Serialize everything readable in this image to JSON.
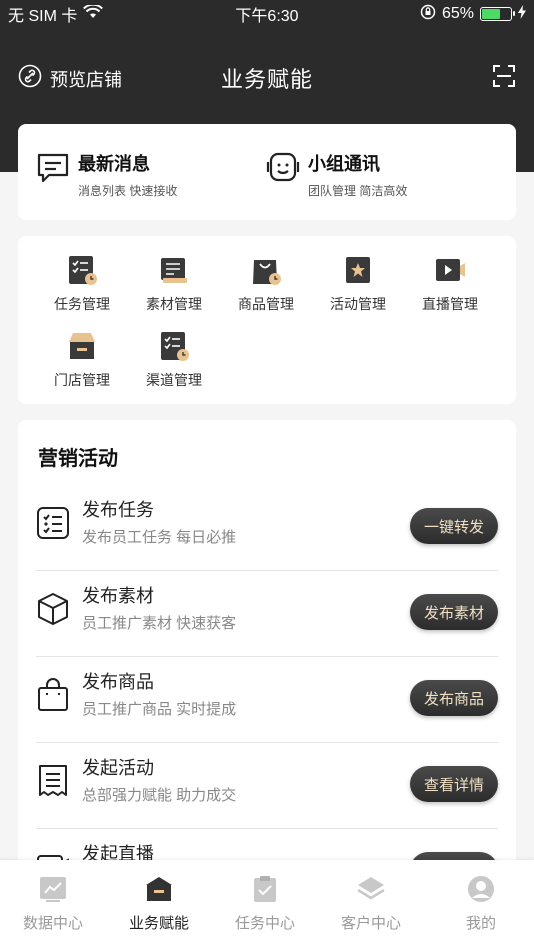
{
  "status": {
    "carrier": "无 SIM 卡",
    "time": "下午6:30",
    "battery": "65%",
    "battery_level": 0.65
  },
  "nav": {
    "left_label": "预览店铺",
    "title": "业务赋能"
  },
  "messages": [
    {
      "title": "最新消息",
      "sub": "消息列表 快速接收",
      "icon": "message-icon"
    },
    {
      "title": "小组通讯",
      "sub": "团队管理 简洁高效",
      "icon": "group-chat-icon"
    }
  ],
  "grid": [
    {
      "label": "任务管理",
      "icon": "task-icon"
    },
    {
      "label": "素材管理",
      "icon": "material-icon"
    },
    {
      "label": "商品管理",
      "icon": "product-icon"
    },
    {
      "label": "活动管理",
      "icon": "activity-icon"
    },
    {
      "label": "直播管理",
      "icon": "live-icon"
    },
    {
      "label": "门店管理",
      "icon": "store-icon"
    },
    {
      "label": "渠道管理",
      "icon": "channel-icon"
    }
  ],
  "marketing": {
    "title": "营销活动",
    "rows": [
      {
        "title": "发布任务",
        "sub": "发布员工任务 每日必推",
        "button": "一键转发",
        "icon": "checklist-icon"
      },
      {
        "title": "发布素材",
        "sub": "员工推广素材 快速获客",
        "button": "发布素材",
        "icon": "box-icon"
      },
      {
        "title": "发布商品",
        "sub": "员工推广商品 实时提成",
        "button": "发布商品",
        "icon": "bag-icon"
      },
      {
        "title": "发起活动",
        "sub": "总部强力赋能 助力成交",
        "button": "查看详情",
        "icon": "receipt-icon"
      },
      {
        "title": "发起直播",
        "sub": "",
        "button": "",
        "icon": "live-row-icon"
      }
    ]
  },
  "tabs": [
    {
      "label": "数据中心",
      "icon": "data-center-icon"
    },
    {
      "label": "业务赋能",
      "icon": "business-icon",
      "active": true
    },
    {
      "label": "任务中心",
      "icon": "task-center-icon"
    },
    {
      "label": "客户中心",
      "icon": "customer-center-icon"
    },
    {
      "label": "我的",
      "icon": "profile-icon"
    }
  ]
}
